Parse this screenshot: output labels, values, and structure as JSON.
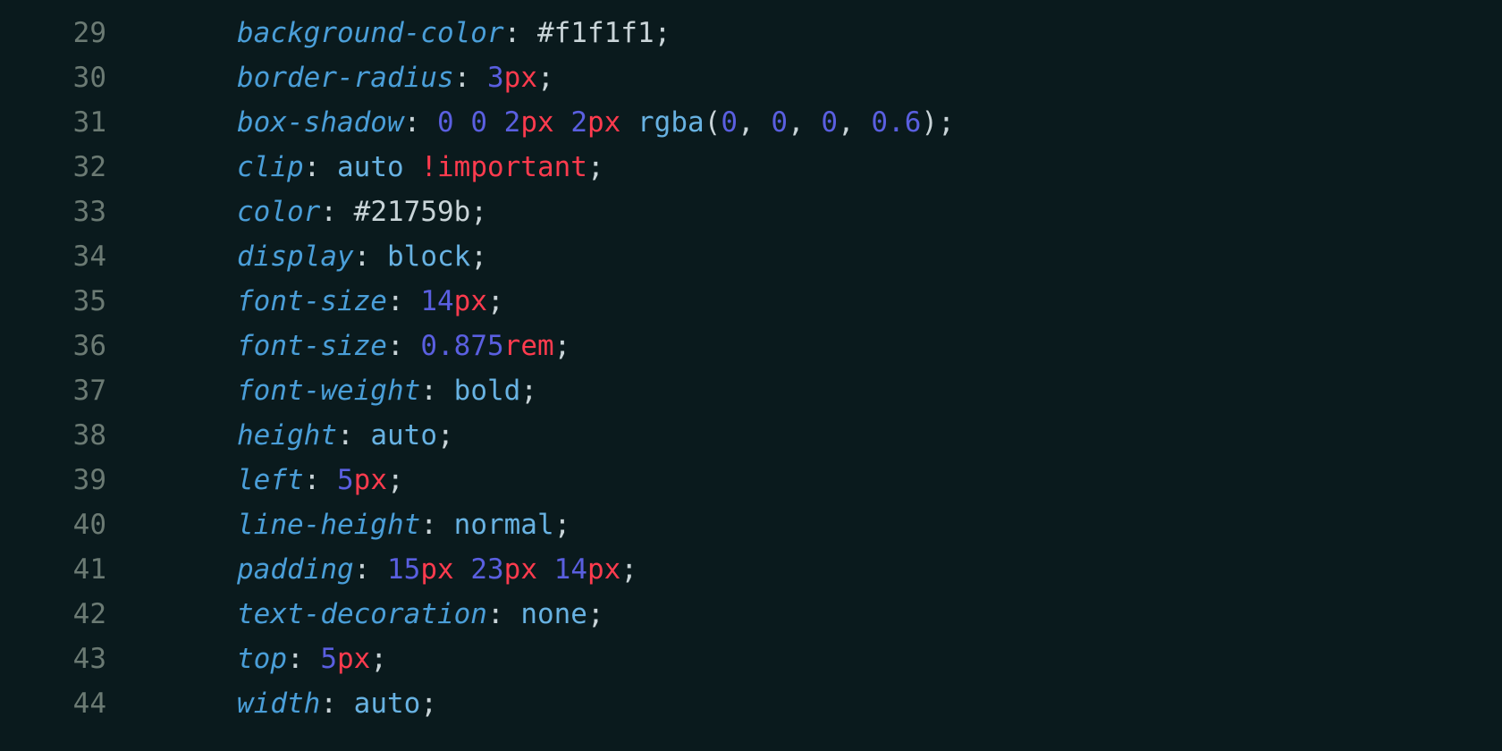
{
  "editor": {
    "startLine": 29,
    "lines": [
      {
        "n": 29,
        "tokens": [
          {
            "t": "background-color",
            "c": "tok-prop"
          },
          {
            "t": ":",
            "c": "tok-punct"
          },
          {
            "t": " ",
            "c": ""
          },
          {
            "t": "#f1f1f1",
            "c": "tok-hex"
          },
          {
            "t": ";",
            "c": "tok-punct"
          }
        ]
      },
      {
        "n": 30,
        "tokens": [
          {
            "t": "border-radius",
            "c": "tok-prop"
          },
          {
            "t": ":",
            "c": "tok-punct"
          },
          {
            "t": " ",
            "c": ""
          },
          {
            "t": "3",
            "c": "tok-num"
          },
          {
            "t": "px",
            "c": "tok-unit"
          },
          {
            "t": ";",
            "c": "tok-punct"
          }
        ]
      },
      {
        "n": 31,
        "tokens": [
          {
            "t": "box-shadow",
            "c": "tok-prop"
          },
          {
            "t": ":",
            "c": "tok-punct"
          },
          {
            "t": " ",
            "c": ""
          },
          {
            "t": "0",
            "c": "tok-num"
          },
          {
            "t": " ",
            "c": ""
          },
          {
            "t": "0",
            "c": "tok-num"
          },
          {
            "t": " ",
            "c": ""
          },
          {
            "t": "2",
            "c": "tok-num"
          },
          {
            "t": "px",
            "c": "tok-unit"
          },
          {
            "t": " ",
            "c": ""
          },
          {
            "t": "2",
            "c": "tok-num"
          },
          {
            "t": "px",
            "c": "tok-unit"
          },
          {
            "t": " ",
            "c": ""
          },
          {
            "t": "rgba",
            "c": "tok-func"
          },
          {
            "t": "(",
            "c": "tok-paren"
          },
          {
            "t": "0",
            "c": "tok-num"
          },
          {
            "t": ",",
            "c": "tok-comma"
          },
          {
            "t": " ",
            "c": ""
          },
          {
            "t": "0",
            "c": "tok-num"
          },
          {
            "t": ",",
            "c": "tok-comma"
          },
          {
            "t": " ",
            "c": ""
          },
          {
            "t": "0",
            "c": "tok-num"
          },
          {
            "t": ",",
            "c": "tok-comma"
          },
          {
            "t": " ",
            "c": ""
          },
          {
            "t": "0.6",
            "c": "tok-num"
          },
          {
            "t": ")",
            "c": "tok-paren"
          },
          {
            "t": ";",
            "c": "tok-punct"
          }
        ]
      },
      {
        "n": 32,
        "tokens": [
          {
            "t": "clip",
            "c": "tok-prop"
          },
          {
            "t": ":",
            "c": "tok-punct"
          },
          {
            "t": " ",
            "c": ""
          },
          {
            "t": "auto",
            "c": "tok-kw"
          },
          {
            "t": " ",
            "c": ""
          },
          {
            "t": "!important",
            "c": "tok-imp"
          },
          {
            "t": ";",
            "c": "tok-punct"
          }
        ]
      },
      {
        "n": 33,
        "tokens": [
          {
            "t": "color",
            "c": "tok-prop"
          },
          {
            "t": ":",
            "c": "tok-punct"
          },
          {
            "t": " ",
            "c": ""
          },
          {
            "t": "#21759b",
            "c": "tok-hex"
          },
          {
            "t": ";",
            "c": "tok-punct"
          }
        ]
      },
      {
        "n": 34,
        "tokens": [
          {
            "t": "display",
            "c": "tok-prop"
          },
          {
            "t": ":",
            "c": "tok-punct"
          },
          {
            "t": " ",
            "c": ""
          },
          {
            "t": "block",
            "c": "tok-kw"
          },
          {
            "t": ";",
            "c": "tok-punct"
          }
        ]
      },
      {
        "n": 35,
        "tokens": [
          {
            "t": "font-size",
            "c": "tok-prop"
          },
          {
            "t": ":",
            "c": "tok-punct"
          },
          {
            "t": " ",
            "c": ""
          },
          {
            "t": "14",
            "c": "tok-num"
          },
          {
            "t": "px",
            "c": "tok-unit"
          },
          {
            "t": ";",
            "c": "tok-punct"
          }
        ]
      },
      {
        "n": 36,
        "tokens": [
          {
            "t": "font-size",
            "c": "tok-prop"
          },
          {
            "t": ":",
            "c": "tok-punct"
          },
          {
            "t": " ",
            "c": ""
          },
          {
            "t": "0.875",
            "c": "tok-num"
          },
          {
            "t": "rem",
            "c": "tok-unit"
          },
          {
            "t": ";",
            "c": "tok-punct"
          }
        ]
      },
      {
        "n": 37,
        "tokens": [
          {
            "t": "font-weight",
            "c": "tok-prop"
          },
          {
            "t": ":",
            "c": "tok-punct"
          },
          {
            "t": " ",
            "c": ""
          },
          {
            "t": "bold",
            "c": "tok-kw"
          },
          {
            "t": ";",
            "c": "tok-punct"
          }
        ]
      },
      {
        "n": 38,
        "tokens": [
          {
            "t": "height",
            "c": "tok-prop"
          },
          {
            "t": ":",
            "c": "tok-punct"
          },
          {
            "t": " ",
            "c": ""
          },
          {
            "t": "auto",
            "c": "tok-kw"
          },
          {
            "t": ";",
            "c": "tok-punct"
          }
        ]
      },
      {
        "n": 39,
        "tokens": [
          {
            "t": "left",
            "c": "tok-prop"
          },
          {
            "t": ":",
            "c": "tok-punct"
          },
          {
            "t": " ",
            "c": ""
          },
          {
            "t": "5",
            "c": "tok-num"
          },
          {
            "t": "px",
            "c": "tok-unit"
          },
          {
            "t": ";",
            "c": "tok-punct"
          }
        ]
      },
      {
        "n": 40,
        "tokens": [
          {
            "t": "line-height",
            "c": "tok-prop"
          },
          {
            "t": ":",
            "c": "tok-punct"
          },
          {
            "t": " ",
            "c": ""
          },
          {
            "t": "normal",
            "c": "tok-kw"
          },
          {
            "t": ";",
            "c": "tok-punct"
          }
        ]
      },
      {
        "n": 41,
        "tokens": [
          {
            "t": "padding",
            "c": "tok-prop"
          },
          {
            "t": ":",
            "c": "tok-punct"
          },
          {
            "t": " ",
            "c": ""
          },
          {
            "t": "15",
            "c": "tok-num"
          },
          {
            "t": "px",
            "c": "tok-unit"
          },
          {
            "t": " ",
            "c": ""
          },
          {
            "t": "23",
            "c": "tok-num"
          },
          {
            "t": "px",
            "c": "tok-unit"
          },
          {
            "t": " ",
            "c": ""
          },
          {
            "t": "14",
            "c": "tok-num"
          },
          {
            "t": "px",
            "c": "tok-unit"
          },
          {
            "t": ";",
            "c": "tok-punct"
          }
        ]
      },
      {
        "n": 42,
        "tokens": [
          {
            "t": "text-decoration",
            "c": "tok-prop"
          },
          {
            "t": ":",
            "c": "tok-punct"
          },
          {
            "t": " ",
            "c": ""
          },
          {
            "t": "none",
            "c": "tok-kw"
          },
          {
            "t": ";",
            "c": "tok-punct"
          }
        ]
      },
      {
        "n": 43,
        "tokens": [
          {
            "t": "top",
            "c": "tok-prop"
          },
          {
            "t": ":",
            "c": "tok-punct"
          },
          {
            "t": " ",
            "c": ""
          },
          {
            "t": "5",
            "c": "tok-num"
          },
          {
            "t": "px",
            "c": "tok-unit"
          },
          {
            "t": ";",
            "c": "tok-punct"
          }
        ]
      },
      {
        "n": 44,
        "tokens": [
          {
            "t": "width",
            "c": "tok-prop"
          },
          {
            "t": ":",
            "c": "tok-punct"
          },
          {
            "t": " ",
            "c": ""
          },
          {
            "t": "auto",
            "c": "tok-kw"
          },
          {
            "t": ";",
            "c": "tok-punct"
          }
        ]
      }
    ]
  }
}
